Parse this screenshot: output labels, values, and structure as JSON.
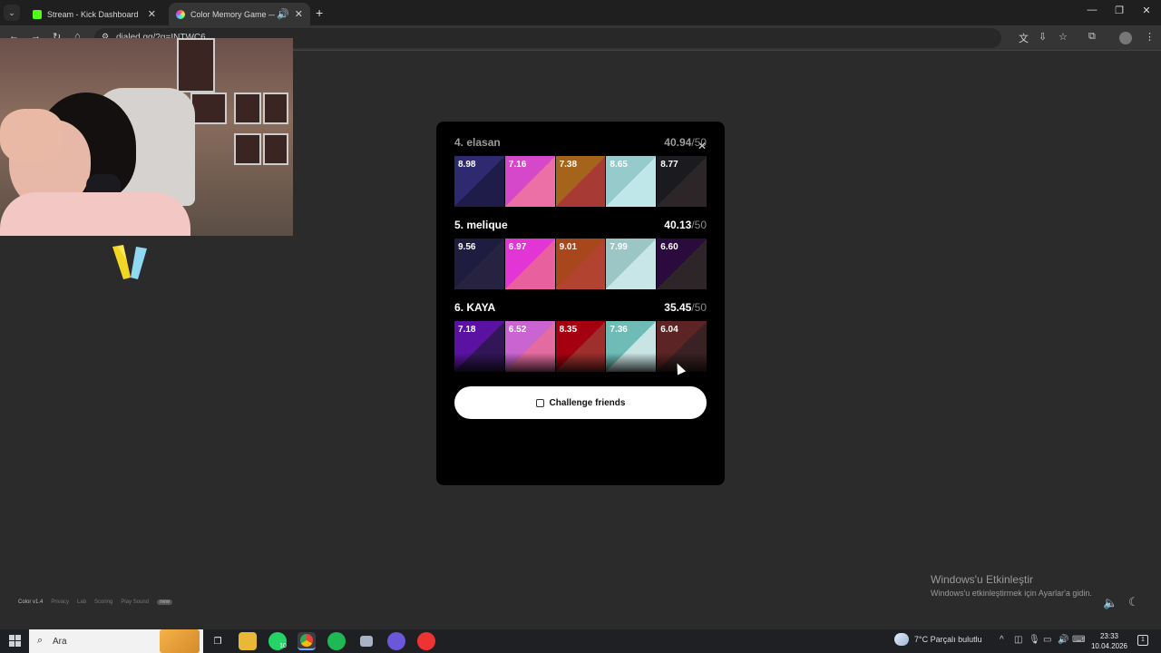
{
  "browser": {
    "tabs": [
      {
        "title": "Stream - Kick Dashboard",
        "favicon_color": "#53fc18"
      },
      {
        "title": "Color Memory Game — Ho",
        "favicon_color": "#e05cd8",
        "active": true
      }
    ],
    "address": "dialed.gg/?g=INTWC6"
  },
  "leaderboard": {
    "entries": [
      {
        "name": "4. elasan",
        "score": "40.94",
        "total": "/50",
        "faded": true,
        "tiles": [
          {
            "value": "8.98",
            "left": "#2e2a6f",
            "right": "#1f1c4a"
          },
          {
            "value": "7.16",
            "left": "#d548c9",
            "right": "#ec6fa6"
          },
          {
            "value": "7.38",
            "left": "#a6631b",
            "right": "#a83a35"
          },
          {
            "value": "8.65",
            "left": "#97cbcb",
            "right": "#bfe7ea"
          },
          {
            "value": "8.77",
            "left": "#1b1b1f",
            "right": "#2c2628"
          }
        ]
      },
      {
        "name": "5. melique",
        "score": "40.13",
        "total": "/50",
        "faded": false,
        "tiles": [
          {
            "value": "9.56",
            "left": "#1f1d3f",
            "right": "#27223f"
          },
          {
            "value": "6.97",
            "left": "#e334d6",
            "right": "#e8609e"
          },
          {
            "value": "9.01",
            "left": "#a8461c",
            "right": "#b24330"
          },
          {
            "value": "7.99",
            "left": "#9cc6c6",
            "right": "#c8e5e8"
          },
          {
            "value": "6.60",
            "left": "#2b0b3e",
            "right": "#2d2528"
          }
        ]
      },
      {
        "name": "6. KAYA",
        "score": "35.45",
        "total": "/50",
        "faded": false,
        "tiles": [
          {
            "value": "7.18",
            "left": "#5b12a2",
            "right": "#331658"
          },
          {
            "value": "6.52",
            "left": "#c964d0",
            "right": "#e36b9f"
          },
          {
            "value": "8.35",
            "left": "#a5000f",
            "right": "#9e2f2c"
          },
          {
            "value": "7.36",
            "left": "#6fbcb7",
            "right": "#c9e4e4"
          },
          {
            "value": "6.04",
            "left": "#5c2424",
            "right": "#3a2224"
          }
        ]
      }
    ],
    "challenge_label": "Challenge friends"
  },
  "footer": {
    "version": "Color v1.4",
    "links": [
      "Privacy",
      "Lab",
      "Scoring",
      "Play Sound"
    ],
    "badge": "new"
  },
  "activation": {
    "title": "Windows'u Etkinleştir",
    "subtitle": "Windows'u etkinleştirmek için Ayarlar'a gidin."
  },
  "taskbar": {
    "search_placeholder": "Ara",
    "whatsapp_badge": "10",
    "weather": "7°C  Parçalı bulutlu",
    "time": "23:33",
    "date": "10.04.2026",
    "notification_count": "1"
  }
}
